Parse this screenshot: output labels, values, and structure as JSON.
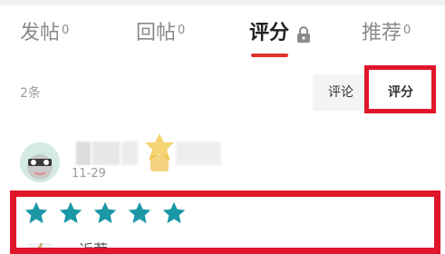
{
  "tabs": [
    {
      "label": "发帖",
      "count": "0"
    },
    {
      "label": "回帖",
      "count": "0"
    },
    {
      "label": "评分",
      "count": ""
    },
    {
      "label": "推荐",
      "count": "0"
    }
  ],
  "list": {
    "count_text": "2条",
    "sort_comment": "评论",
    "sort_score": "评分"
  },
  "review": {
    "date": "11-29",
    "rating": 5,
    "partial_text": "近荐"
  },
  "colors": {
    "accent": "#e1342f",
    "highlight": "#e0162b",
    "star": "#1a98a6"
  },
  "icons": {
    "lock": "lock-icon",
    "star": "star-icon"
  }
}
